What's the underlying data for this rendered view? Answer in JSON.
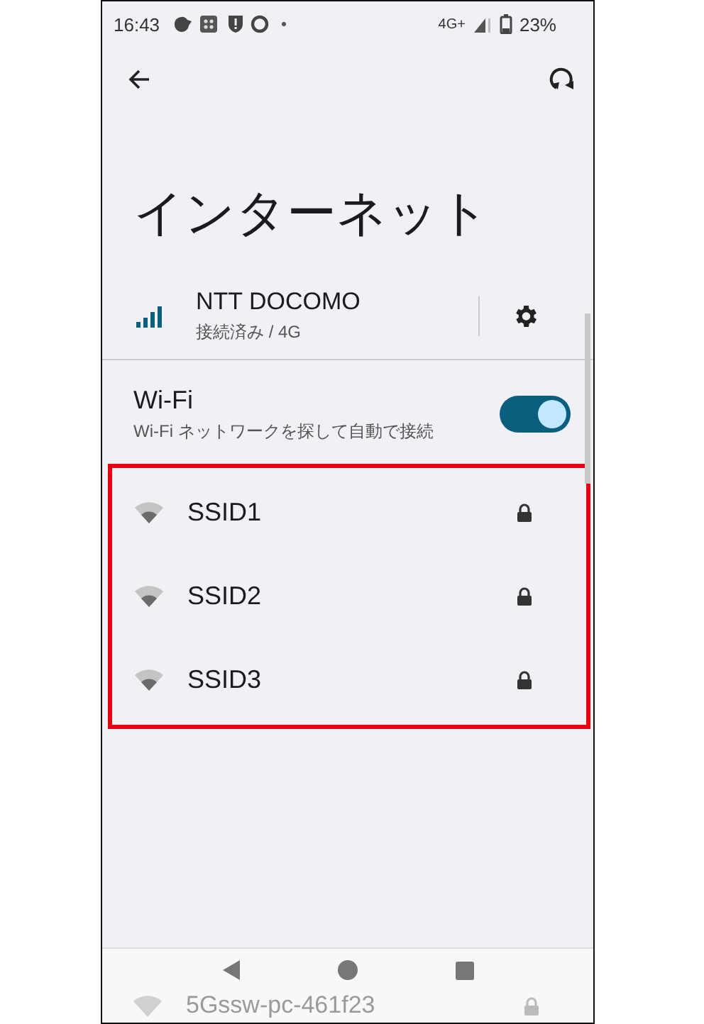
{
  "status_bar": {
    "time": "16:43",
    "network": "4G+",
    "battery": "23%"
  },
  "title": "インターネット",
  "mobile": {
    "carrier": "NTT DOCOMO",
    "status": "接続済み / 4G"
  },
  "wifi": {
    "label": "Wi-Fi",
    "description": "Wi-Fi ネットワークを探して自動で接続",
    "on": true
  },
  "networks": [
    {
      "ssid": "SSID1",
      "locked": true
    },
    {
      "ssid": "SSID2",
      "locked": true
    },
    {
      "ssid": "SSID3",
      "locked": true
    }
  ],
  "partial_network": {
    "ssid": "5Gssw-pc-461f23",
    "locked": true
  }
}
